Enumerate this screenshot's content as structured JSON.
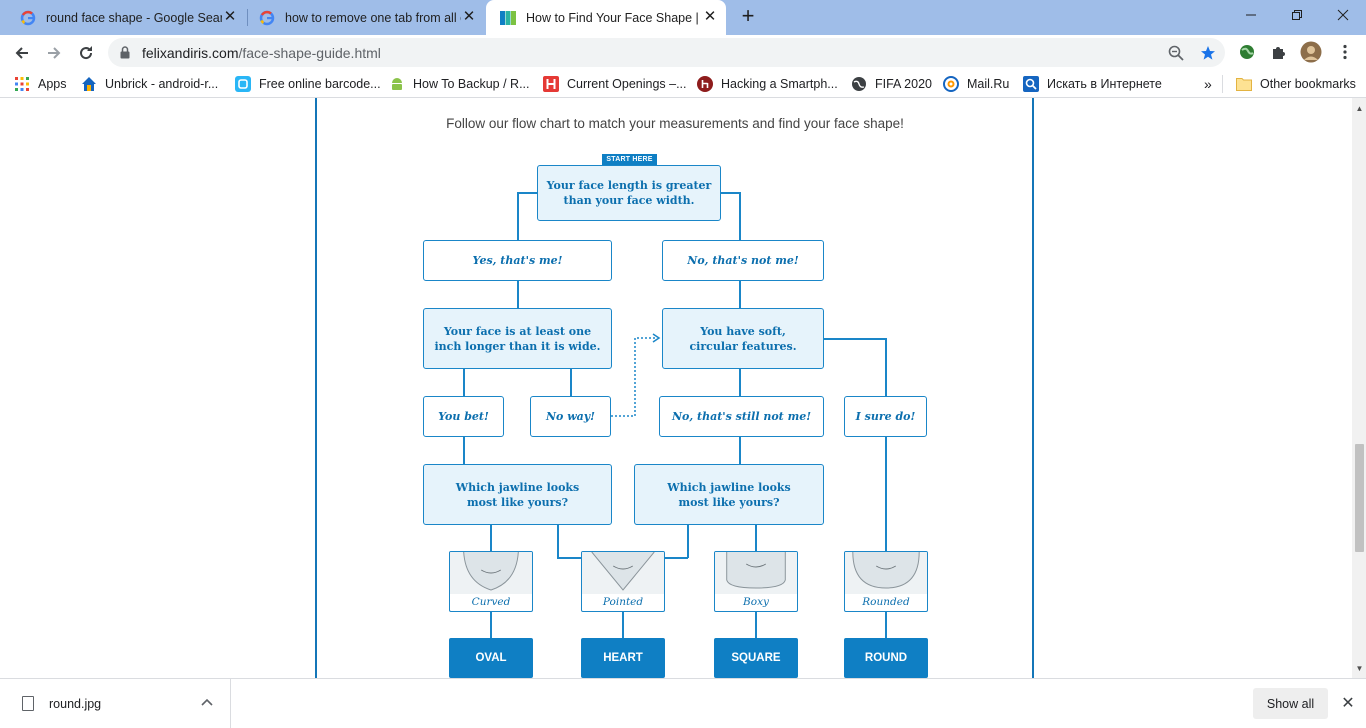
{
  "browser": {
    "tabs": [
      {
        "title": "round face shape - Google Search",
        "favicon": "google-g-icon",
        "active": false
      },
      {
        "title": "how to remove one tab from all other tabs",
        "favicon": "google-g-icon",
        "active": false
      },
      {
        "title": "How to Find Your Face Shape | felixandiris",
        "favicon": "felixandiris-icon",
        "active": true
      }
    ],
    "new_tab": "+",
    "url_host": "felixandiris.com",
    "url_path": "/face-shape-guide.html",
    "bookmarks": [
      {
        "label": "Apps",
        "icon": "apps-grid-icon"
      },
      {
        "label": "Unbrick - android-r...",
        "icon": "home-icon"
      },
      {
        "label": "Free online barcode...",
        "icon": "barcode-icon"
      },
      {
        "label": "How To Backup / R...",
        "icon": "android-icon"
      },
      {
        "label": "Current Openings –...",
        "icon": "h-logo-icon"
      },
      {
        "label": "Hacking a Smartph...",
        "icon": "h-circle-icon"
      },
      {
        "label": "FIFA 2020",
        "icon": "globe-icon"
      },
      {
        "label": "Mail.Ru",
        "icon": "mailru-icon"
      },
      {
        "label": "Искать в Интернете",
        "icon": "search-square-icon"
      }
    ],
    "bookmarks_overflow": "»",
    "other_bookmarks": "Other bookmarks"
  },
  "page": {
    "lead": "Follow our flow chart to match your measurements and find your face shape!",
    "start_tag": "START HERE",
    "q1": [
      "Your face length is greater",
      "than your face width."
    ],
    "yes1": "Yes, that's me!",
    "no1": "No, that's not me!",
    "q2": [
      "Your face is at least one",
      "inch longer than it is wide."
    ],
    "q3": [
      "You have soft,",
      "circular features."
    ],
    "you_bet": "You bet!",
    "no_way": "No way!",
    "still_not": "No, that's still not me!",
    "sure_do": "I sure do!",
    "jaw_q_left": [
      "Which jawline looks",
      "most like yours?"
    ],
    "jaw_q_right": [
      "Which jawline looks",
      "most like yours?"
    ],
    "jawlines": [
      "Curved",
      "Pointed",
      "Boxy",
      "Rounded"
    ],
    "results": [
      "OVAL",
      "HEART",
      "SQUARE",
      "ROUND"
    ]
  },
  "downloads": {
    "file": "round.jpg",
    "show_all": "Show all"
  }
}
